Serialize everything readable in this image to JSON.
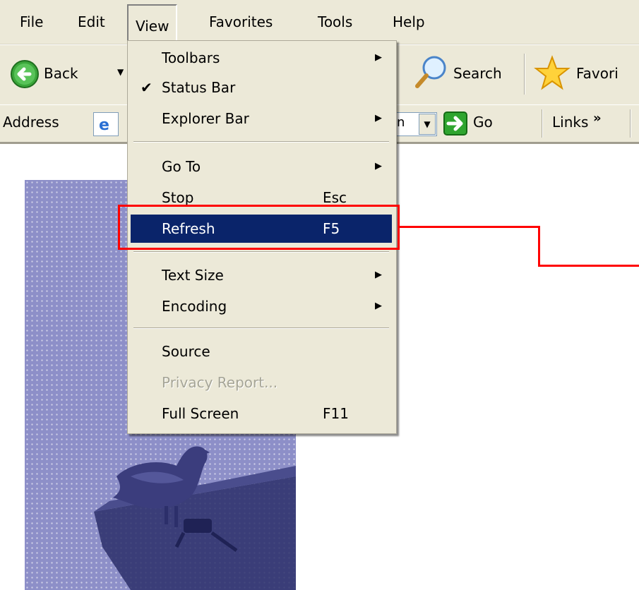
{
  "menubar": {
    "items": [
      {
        "label": "File"
      },
      {
        "label": "Edit"
      },
      {
        "label": "View"
      },
      {
        "label": "Favorites"
      },
      {
        "label": "Tools"
      },
      {
        "label": "Help"
      }
    ]
  },
  "toolbar": {
    "back_label": "Back",
    "search_label": "Search",
    "favorites_label": "Favori"
  },
  "addressbar": {
    "address_label": "Address",
    "go_label": "Go",
    "links_label": "Links",
    "links_chevron": "»",
    "combo_fragment": "n"
  },
  "view_menu": {
    "items": [
      {
        "label": "Toolbars",
        "accel": "",
        "submenu": true
      },
      {
        "label": "Status Bar",
        "accel": "",
        "checked": true
      },
      {
        "label": "Explorer Bar",
        "accel": "",
        "submenu": true
      },
      {
        "label": "Go To",
        "accel": "",
        "submenu": true
      },
      {
        "label": "Stop",
        "accel": "Esc"
      },
      {
        "label": "Refresh",
        "accel": "F5",
        "highlighted": true
      },
      {
        "label": "Text Size",
        "accel": "",
        "submenu": true
      },
      {
        "label": "Encoding",
        "accel": "",
        "submenu": true
      },
      {
        "label": "Source",
        "accel": ""
      },
      {
        "label": "Privacy Report...",
        "accel": "",
        "disabled": true
      },
      {
        "label": "Full Screen",
        "accel": "F11"
      }
    ]
  },
  "colors": {
    "chrome": "#ece9d8",
    "highlight": "#0a246a",
    "annotation": "#ff0000",
    "image_tint": "#8d8fc8"
  }
}
